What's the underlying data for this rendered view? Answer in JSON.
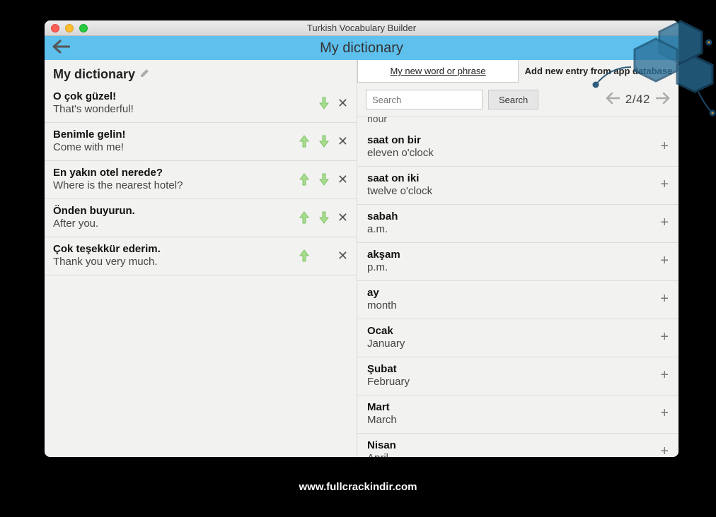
{
  "window": {
    "title": "Turkish Vocabulary Builder"
  },
  "header": {
    "title": "My dictionary"
  },
  "panel": {
    "title": "My dictionary"
  },
  "dict": [
    {
      "tr": "O çok güzel!",
      "en": "That's wonderful!",
      "up": false,
      "down": true
    },
    {
      "tr": "Benimle gelin!",
      "en": "Come with me!",
      "up": true,
      "down": true
    },
    {
      "tr": "En yakın otel nerede?",
      "en": "Where is the nearest hotel?",
      "up": true,
      "down": true
    },
    {
      "tr": "Önden buyurun.",
      "en": "After you.",
      "up": true,
      "down": true
    },
    {
      "tr": "Çok teşekkür ederim.",
      "en": "Thank you very much.",
      "up": true,
      "down": false
    }
  ],
  "tabs": {
    "mynew": "My new word or phrase",
    "addfrom": "Add new entry from app database"
  },
  "search": {
    "placeholder": "Search",
    "button": "Search"
  },
  "pager": {
    "current": 2,
    "total": 42,
    "text": "2/42"
  },
  "db_clip": "hour",
  "db": [
    {
      "tr": "saat on bir",
      "en": "eleven o'clock"
    },
    {
      "tr": "saat on iki",
      "en": "twelve o'clock"
    },
    {
      "tr": "sabah",
      "en": "a.m."
    },
    {
      "tr": "akşam",
      "en": "p.m."
    },
    {
      "tr": "ay",
      "en": "month"
    },
    {
      "tr": "Ocak",
      "en": "January"
    },
    {
      "tr": "Şubat",
      "en": "February"
    },
    {
      "tr": "Mart",
      "en": "March"
    },
    {
      "tr": "Nisan",
      "en": "April"
    }
  ],
  "footer": {
    "url": "www.fullcrackindir.com"
  }
}
